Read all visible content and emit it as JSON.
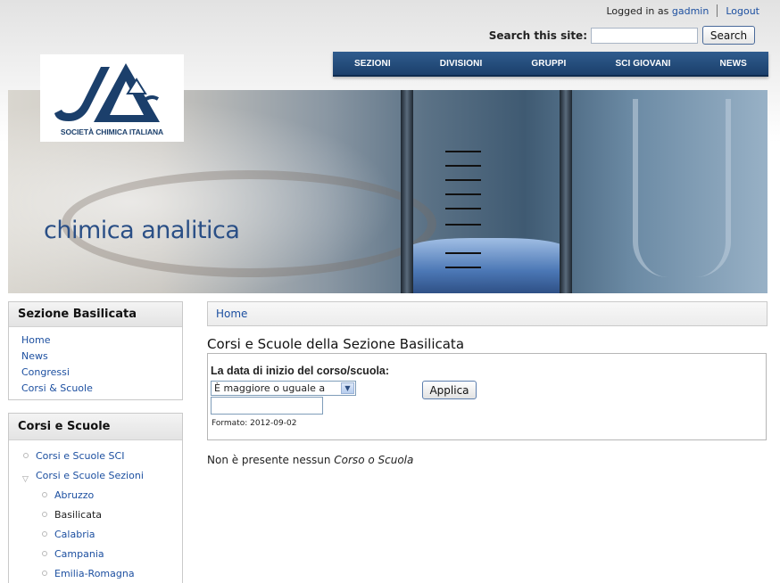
{
  "header": {
    "logged_in_prefix": "Logged in as",
    "username": "gadmin",
    "logout": "Logout",
    "search_label": "Search this site:",
    "search_value": "",
    "search_button": "Search"
  },
  "nav": {
    "items": [
      {
        "label": "SEZIONI"
      },
      {
        "label": "DIVISIONI"
      },
      {
        "label": "GRUPPI"
      },
      {
        "label": "SCI GIOVANI"
      },
      {
        "label": "NEWS"
      }
    ]
  },
  "logo": {
    "caption": "SOCIETÀ CHIMICA ITALIANA",
    "color": "#1b3f6b"
  },
  "banner": {
    "title": "chimica analitica"
  },
  "sidebar": {
    "section_box": {
      "title": "Sezione Basilicata",
      "items": [
        {
          "label": "Home"
        },
        {
          "label": "News"
        },
        {
          "label": "Congressi"
        },
        {
          "label": "Corsi & Scuole"
        }
      ]
    },
    "courses_box": {
      "title": "Corsi e Scuole",
      "items": [
        {
          "label": "Corsi e Scuole SCI"
        },
        {
          "label": "Corsi e Scuole Sezioni"
        }
      ],
      "regions": [
        {
          "label": "Abruzzo"
        },
        {
          "label": "Basilicata"
        },
        {
          "label": "Calabria"
        },
        {
          "label": "Campania"
        },
        {
          "label": "Emilia-Romagna"
        }
      ]
    }
  },
  "main": {
    "breadcrumb": "Home",
    "title": "Corsi e Scuole della Sezione Basilicata",
    "filter": {
      "label": "La data di inizio del corso/scuola:",
      "operator": "È maggiore o uguale a",
      "date_value": "",
      "format_hint": "Formato: 2012-09-02",
      "apply_button": "Applica"
    },
    "empty_prefix": "Non è presente nessun",
    "empty_item": "Corso o Scuola"
  },
  "colors": {
    "nav_bg": "#1b3f6b",
    "link": "#1c4fa0",
    "banner_title": "#2a4f86"
  }
}
